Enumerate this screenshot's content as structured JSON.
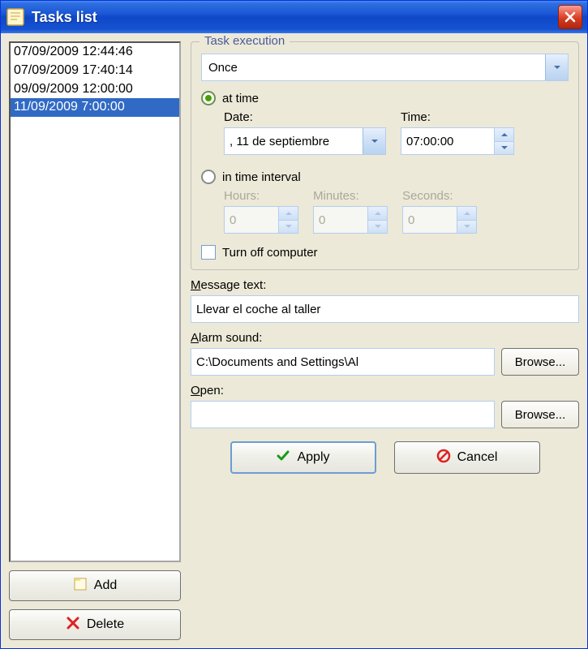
{
  "window": {
    "title": "Tasks list"
  },
  "tasks": {
    "items": [
      {
        "label": "07/09/2009 12:44:46",
        "selected": false
      },
      {
        "label": "07/09/2009 17:40:14",
        "selected": false
      },
      {
        "label": "09/09/2009 12:00:00",
        "selected": false
      },
      {
        "label": "11/09/2009 7:00:00",
        "selected": true
      }
    ]
  },
  "leftActions": {
    "add_label": "Add",
    "delete_label": "Delete"
  },
  "execution": {
    "legend": "Task execution",
    "frequency_selected": "Once",
    "radio_at_time_label": "at time",
    "radio_interval_label": "in time interval",
    "radio_choice": "at_time",
    "date_label": "Date:",
    "date_value": ", 11 de septiembre",
    "time_label": "Time:",
    "time_value": "07:00:00",
    "interval": {
      "hours_label": "Hours:",
      "hours_value": "0",
      "minutes_label": "Minutes:",
      "minutes_value": "0",
      "seconds_label": "Seconds:",
      "seconds_value": "0"
    },
    "turnoff_label": "Turn off computer",
    "turnoff_checked": false
  },
  "message": {
    "label": "Message text:",
    "value": "Llevar el coche al taller"
  },
  "alarm": {
    "label": "Alarm sound:",
    "value": "C:\\Documents and Settings\\Al",
    "browse_label": "Browse..."
  },
  "open": {
    "label": "Open:",
    "value": "",
    "browse_label": "Browse..."
  },
  "actions": {
    "apply_label": "Apply",
    "cancel_label": "Cancel"
  }
}
